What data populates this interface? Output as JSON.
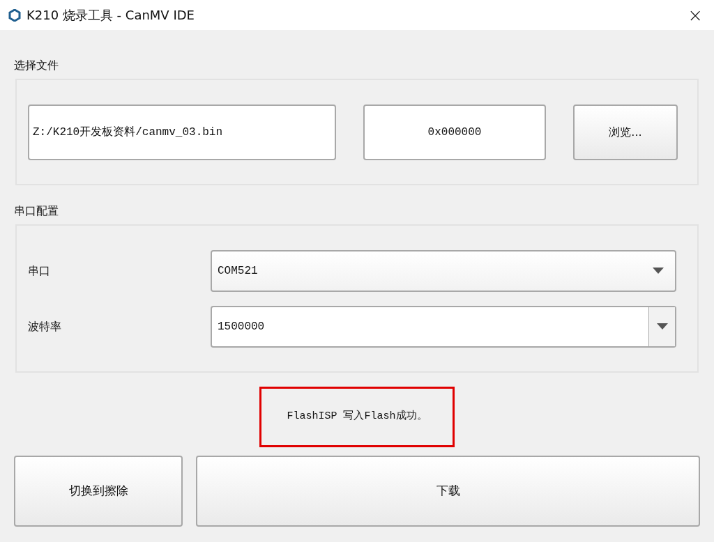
{
  "window": {
    "title": "K210 烧录工具 - CanMV IDE",
    "close": "×"
  },
  "file_section": {
    "title": "选择文件",
    "path": "Z:/K210开发板资料/canmv_03.bin",
    "address": "0x000000",
    "browse_button": "浏览..."
  },
  "serial_section": {
    "title": "串口配置",
    "rows": [
      {
        "label": "串口",
        "kind": "dropdown",
        "value": "COM521"
      },
      {
        "label": "波特率",
        "kind": "editable",
        "value": "1500000"
      }
    ]
  },
  "status": {
    "text": "FlashISP 写入Flash成功。",
    "highlighted": true
  },
  "buttons": [
    {
      "label": "切换到擦除"
    },
    {
      "label": "下载"
    }
  ]
}
